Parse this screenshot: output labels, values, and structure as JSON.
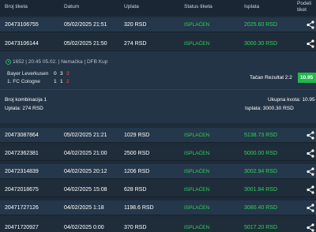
{
  "table": {
    "headers": {
      "id": "Broj tiketa",
      "date": "Datum",
      "amount": "Uplata",
      "status": "Status tiketa",
      "win": "Isplata",
      "share_line1": "Podeli",
      "share_line2": "tiket"
    },
    "rows": [
      {
        "id": "20473106755",
        "date": "05/02/2025 21:51",
        "amount": "320 RSD",
        "status": "ISPLAĆEN",
        "win": "2025.60 RSD"
      },
      {
        "id": "20473106144",
        "date": "05/02/2025 21:50",
        "amount": "274 RSD",
        "status": "ISPLAĆEN",
        "win": "3000.30 RSD"
      },
      {
        "id": "20473087864",
        "date": "05/02/2025 21:21",
        "amount": "1029 RSD",
        "status": "ISPLAĆEN",
        "win": "5138.73 RSD"
      },
      {
        "id": "20472362381",
        "date": "04/02/2025 21:00",
        "amount": "2500 RSD",
        "status": "ISPLAĆEN",
        "win": "5000.00 RSD"
      },
      {
        "id": "20472314839",
        "date": "04/02/2025 20:12",
        "amount": "1206 RSD",
        "status": "ISPLAĆEN",
        "win": "3002.94 RSD"
      },
      {
        "id": "20472018675",
        "date": "04/02/2025 15:08",
        "amount": "628 RSD",
        "status": "ISPLAĆEN",
        "win": "3001.84 RSD"
      },
      {
        "id": "20471727126",
        "date": "04/02/2025 1:18",
        "amount": "1198.6 RSD",
        "status": "ISPLAĆEN",
        "win": "3080.40 RSD"
      },
      {
        "id": "20471720927",
        "date": "04/02/2025 0:00",
        "amount": "370 RSD",
        "status": "ISPLAĆEN",
        "win": "5017.20 RSD"
      }
    ]
  },
  "detail": {
    "match_info": "1652 | 20:45 05.02. | Nemačka | DFB Kup",
    "home_team": "Bayer Leverkusen",
    "home_scores": [
      "0",
      "3",
      "3"
    ],
    "away_team": "1. FC Cologne",
    "away_scores": [
      "1",
      "1",
      "2"
    ],
    "tip_label": "Tačan Rezultat 2:2",
    "tip_odd": "10.95",
    "combinations": "Broj kombinacija 1",
    "stake": "Uplata: 274 RSD",
    "total_odd": "Ukupna kvota: 10.95",
    "payout": "Isplata: 3000.30 RSD"
  },
  "colors": {
    "background": "#1e2c3a",
    "success_green": "#2fd15a",
    "odd_badge": "#21b94b",
    "score_red": "#ff4a4a"
  },
  "icons": {
    "share": "share-icon",
    "clock": "clock-icon"
  }
}
